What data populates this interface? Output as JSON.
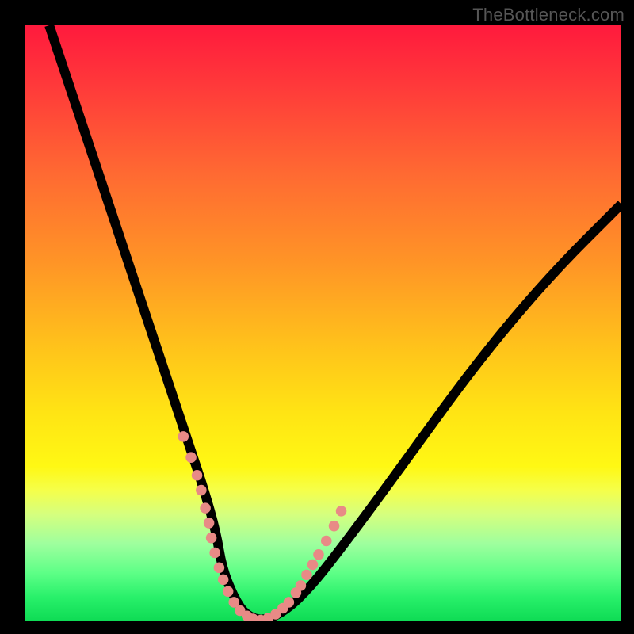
{
  "watermark": "TheBottleneck.com",
  "chart_data": {
    "type": "line",
    "title": "",
    "xlabel": "",
    "ylabel": "",
    "xlim": [
      0,
      100
    ],
    "ylim": [
      0,
      100
    ],
    "background": "rainbow-gradient red-to-green (vertical)",
    "series": [
      {
        "name": "bottleneck-curve",
        "x": [
          4,
          8,
          12,
          16,
          20,
          24,
          28,
          30,
          32,
          33,
          35,
          37,
          40,
          44,
          48,
          52,
          58,
          66,
          74,
          82,
          90,
          98,
          100
        ],
        "y": [
          100,
          88,
          76,
          64,
          52,
          40,
          28,
          22,
          15,
          9,
          4,
          1,
          0,
          2,
          6,
          11,
          19,
          30,
          41,
          51,
          60,
          68,
          70
        ]
      }
    ],
    "highlight_points": {
      "name": "highlighted-range-dots",
      "color": "#e88a86",
      "x": [
        26.5,
        27.8,
        28.8,
        29.5,
        30.2,
        30.8,
        31.2,
        31.8,
        32.5,
        33.2,
        34.0,
        35.0,
        36.0,
        37.2,
        38.2,
        39.5,
        40.7,
        42.0,
        43.2,
        44.2,
        45.4,
        46.2,
        47.2,
        48.2,
        49.2,
        50.5,
        51.8,
        53.0
      ],
      "y": [
        31.0,
        27.5,
        24.5,
        22.0,
        19.0,
        16.5,
        14.0,
        11.5,
        9.0,
        7.0,
        5.0,
        3.2,
        1.8,
        0.9,
        0.4,
        0.2,
        0.5,
        1.2,
        2.2,
        3.2,
        4.8,
        6.0,
        7.8,
        9.5,
        11.2,
        13.5,
        16.0,
        18.5
      ]
    }
  }
}
